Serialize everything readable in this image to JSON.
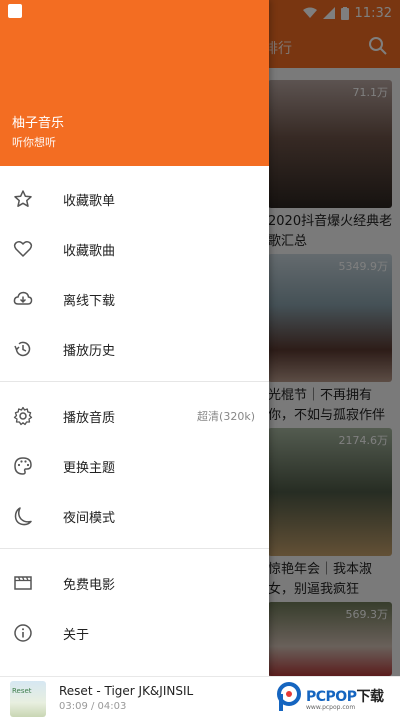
{
  "status_bar": {
    "time": "11:32"
  },
  "background": {
    "tab_label": "排行",
    "cards": [
      {
        "count": "71.1万",
        "title": "2020抖音爆火经典老"
      },
      {
        "count": "5349.9万",
        "title": "光棍节｜不再拥有"
      },
      {
        "count": "2174.6万",
        "title": "惊艳年会｜我本淑"
      },
      {
        "count": "569.3万",
        "title": ""
      }
    ],
    "card_title_lines": [
      "歌汇总",
      "你，不如与孤寂作伴",
      "女，别逼我疯狂"
    ]
  },
  "drawer": {
    "app_name": "柚子音乐",
    "app_subtitle": "听你想听",
    "menu_groups": [
      [
        {
          "label": "收藏歌单",
          "icon": "star-icon"
        },
        {
          "label": "收藏歌曲",
          "icon": "heart-icon"
        },
        {
          "label": "离线下载",
          "icon": "cloud-download-icon"
        },
        {
          "label": "播放历史",
          "icon": "history-icon"
        }
      ],
      [
        {
          "label": "播放音质",
          "icon": "gear-icon",
          "value": "超清(320k)"
        },
        {
          "label": "更换主题",
          "icon": "palette-icon"
        },
        {
          "label": "夜间模式",
          "icon": "moon-icon"
        }
      ],
      [
        {
          "label": "免费电影",
          "icon": "movie-icon"
        },
        {
          "label": "关于",
          "icon": "info-icon"
        }
      ]
    ]
  },
  "player": {
    "song": "Reset - Tiger JK&JINSIL",
    "time": "03:09 / 04:03",
    "cover_text": "Reset"
  },
  "watermark": {
    "brand": "PCPOP",
    "suffix": "下载",
    "sub": "www.pcpop.com"
  },
  "colors": {
    "accent": "#f36d22"
  }
}
